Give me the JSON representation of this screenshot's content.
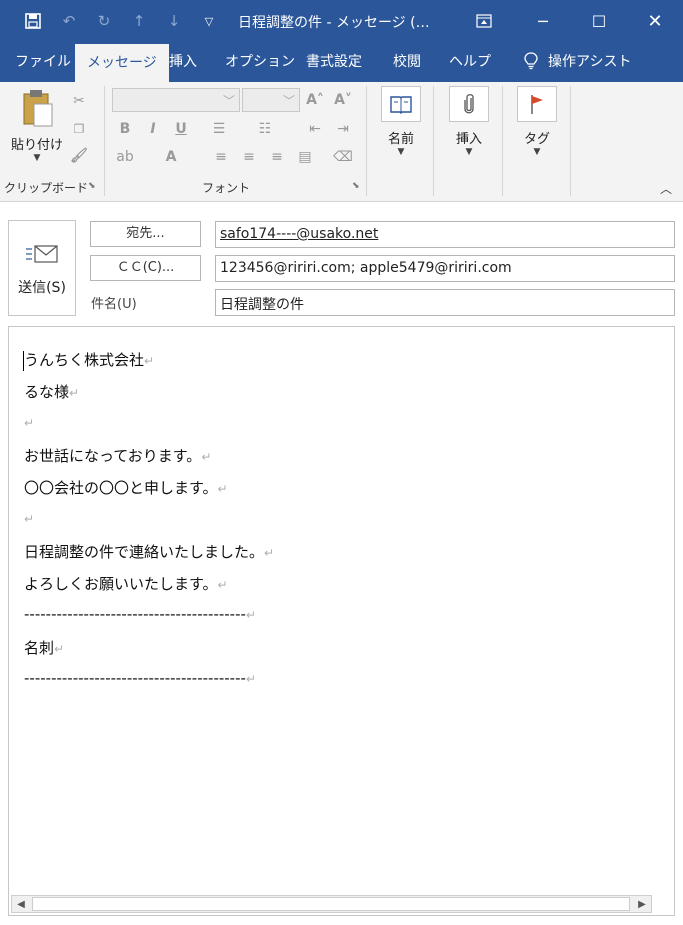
{
  "window": {
    "title": "日程調整の件 - メッセージ (…"
  },
  "tabs": [
    "ファイル",
    "メッセージ",
    "挿入",
    "オプション",
    "書式設定",
    "校閲",
    "ヘルプ",
    "操作アシスト"
  ],
  "ribbon": {
    "clipboard": {
      "paste_label": "貼り付け",
      "group_label": "クリップボード"
    },
    "font": {
      "group_label": "フォント"
    },
    "names_label": "名前",
    "insert_label": "挿入",
    "tag_label": "タグ"
  },
  "message": {
    "send_label": "送信(S)",
    "to_button": "宛先...",
    "cc_button": "ＣＣ(C)...",
    "subject_label": "件名(U)",
    "to_value": "safo174----@usako.net",
    "cc_value": "123456@ririri.com; apple5479@ririri.com",
    "subject_value": "日程調整の件"
  },
  "body_lines": [
    "うんちく株式会社",
    "るな様",
    "",
    "お世話になっております。",
    "〇〇会社の〇〇と申します。",
    "",
    "日程調整の件で連絡いたしました。",
    "よろしくお願いいたします。",
    "-----------------------------------------",
    "名刺",
    "-----------------------------------------"
  ],
  "colors": {
    "accent": "#2b579a",
    "ribbon_bg": "#f3f3f3"
  }
}
